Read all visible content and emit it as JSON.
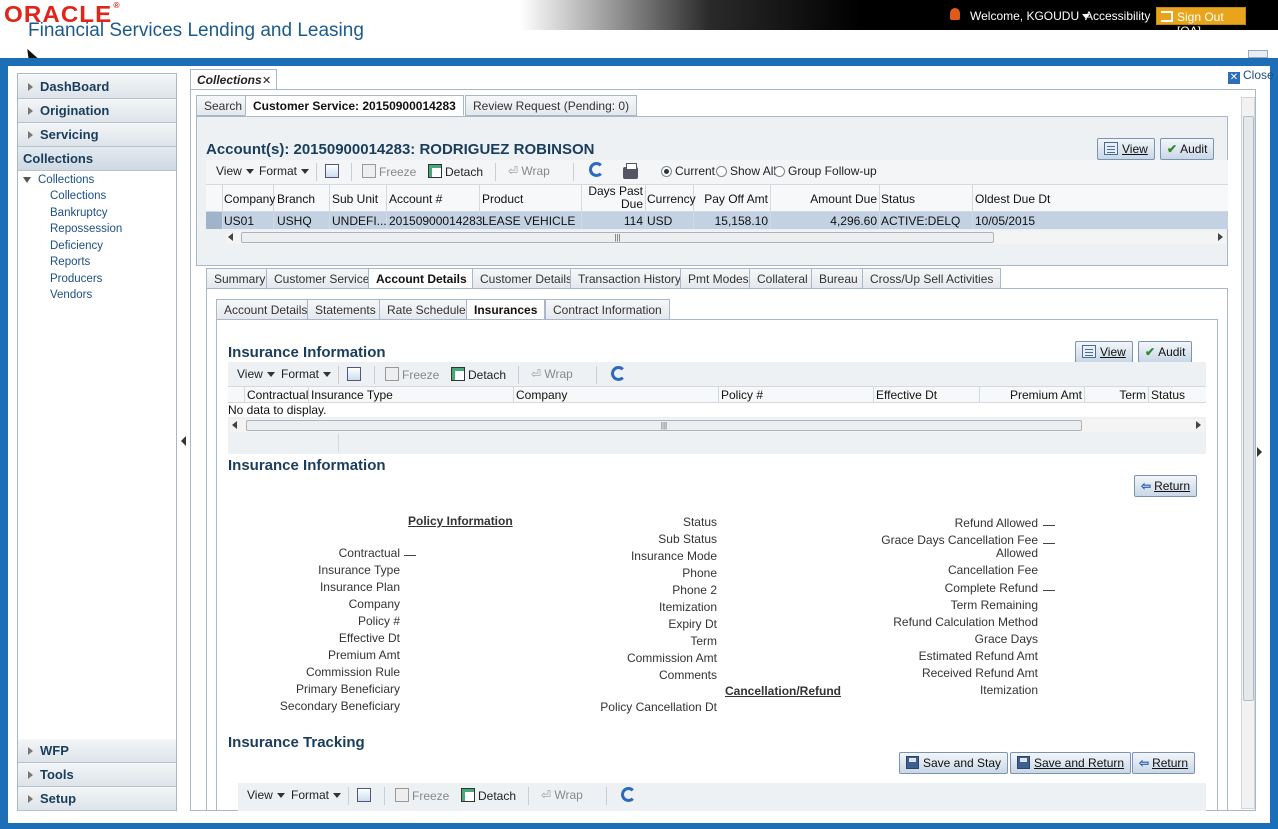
{
  "header": {
    "logo": "ORACLE",
    "app_title": "Financial Services Lending and Leasing",
    "welcome": "Welcome, KGOUDU",
    "accessibility": "Accessibility",
    "signout": "Sign Out [QA]"
  },
  "left_nav": {
    "sections_top": [
      "DashBoard",
      "Origination",
      "Servicing"
    ],
    "current": "Collections",
    "tree_root": "Collections",
    "tree_items": [
      "Collections",
      "Bankruptcy",
      "Repossession",
      "Deficiency",
      "Reports",
      "Producers",
      "Vendors"
    ],
    "sections_bottom": [
      "WFP",
      "Tools",
      "Setup"
    ]
  },
  "main": {
    "tab": "Collections",
    "close": "Close",
    "top_tabs": [
      "Search",
      "Customer Service: 20150900014283",
      "Review Request (Pending: 0)"
    ],
    "account_title": "Account(s): 20150900014283: RODRIGUEZ ROBINSON",
    "view_btn": "View",
    "audit_btn": "Audit",
    "toolbar": {
      "view": "View",
      "format": "Format",
      "freeze": "Freeze",
      "detach": "Detach",
      "wrap": "Wrap"
    },
    "radios": [
      "Current",
      "Show All",
      "Group Follow-up"
    ],
    "acct_table": {
      "headers": [
        "Company",
        "Branch",
        "Sub Unit",
        "Account #",
        "Product",
        "Days Past Due",
        "Currency",
        "Pay Off Amt",
        "Amount Due",
        "Status",
        "Oldest Due Dt"
      ],
      "row": [
        "US01",
        "USHQ",
        "UNDEFI...",
        "20150900014283",
        "LEASE VEHICLE",
        "114",
        "USD",
        "15,158.10",
        "4,296.60",
        "ACTIVE:DELQ",
        "10/05/2015"
      ]
    },
    "cs_tabs": [
      "Summary",
      "Customer Service",
      "Account Details",
      "Customer Details",
      "Transaction History",
      "Pmt Modes",
      "Collateral",
      "Bureau",
      "Cross/Up Sell Activities"
    ],
    "sub_tabs": [
      "Account Details",
      "Statements",
      "Rate Schedule",
      "Insurances",
      "Contract Information"
    ],
    "ins_info": {
      "title": "Insurance Information",
      "headers": [
        "Contractual",
        "Insurance Type",
        "Company",
        "Policy #",
        "Effective Dt",
        "Premium Amt",
        "Term",
        "Status"
      ],
      "no_data": "No data to display."
    },
    "ins_detail": {
      "title": "Insurance Information",
      "return_btn": "Return",
      "policy_header": "Policy Information",
      "col1": [
        "Contractual",
        "Insurance Type",
        "Insurance Plan",
        "Company",
        "Policy #",
        "Effective Dt",
        "Premium Amt",
        "Commission Rule",
        "Primary Beneficiary",
        "Secondary Beneficiary"
      ],
      "col2": [
        "Status",
        "Sub Status",
        "Insurance Mode",
        "Phone",
        "Phone 2",
        "Itemization",
        "Expiry Dt",
        "Term",
        "Commission Amt",
        "Comments"
      ],
      "policy_cancel": "Policy Cancellation Dt",
      "cancel_header": "Cancellation/Refund",
      "col3": [
        "Refund Allowed",
        "Grace Days Cancellation Fee",
        "Allowed",
        "Cancellation Fee",
        "Complete Refund",
        "Term Remaining",
        "Refund Calculation Method",
        "Grace Days",
        "Estimated Refund Amt",
        "Received Refund Amt",
        "Itemization"
      ]
    },
    "tracking": {
      "title": "Insurance Tracking",
      "save_stay": "Save and Stay",
      "save_return": "Save and Return",
      "return_btn": "Return"
    }
  }
}
